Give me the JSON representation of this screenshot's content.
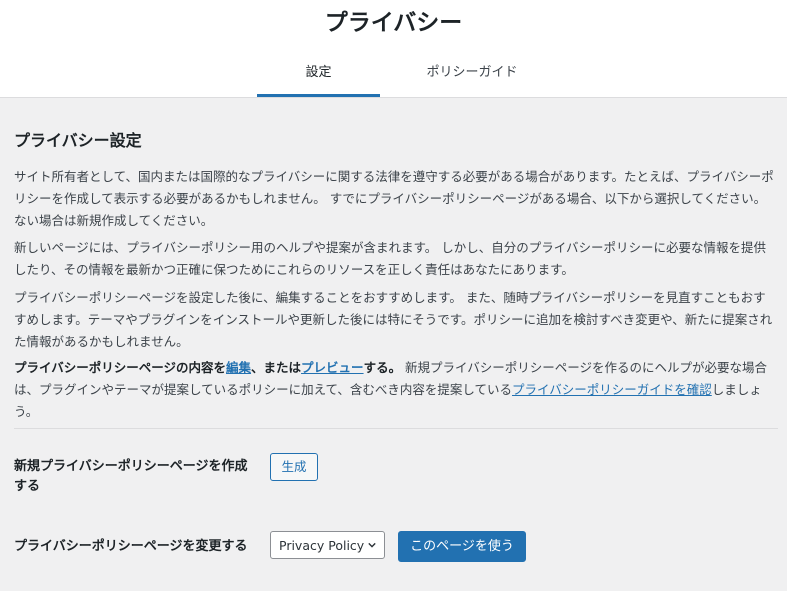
{
  "header": {
    "title": "プライバシー",
    "tabs": [
      {
        "label": "設定",
        "active": true
      },
      {
        "label": "ポリシーガイド",
        "active": false
      }
    ]
  },
  "section": {
    "title": "プライバシー設定",
    "p1": "サイト所有者として、国内または国際的なプライバシーに関する法律を遵守する必要がある場合があります。たとえば、プライバシーポリシーを作成して表示する必要があるかもしれません。 すでにプライバシーポリシーページがある場合、以下から選択してください。ない場合は新規作成してください。",
    "p2": "新しいページには、プライバシーポリシー用のヘルプや提案が含まれます。 しかし、自分のプライバシーポリシーに必要な情報を提供したり、その情報を最新かつ正確に保つためにこれらのリソースを正しく責任はあなたにあります。",
    "p3": "プライバシーポリシーページを設定した後に、編集することをおすすめします。 また、随時プライバシーポリシーを見直すこともおすすめします。テーマやプラグインをインストールや更新した後には特にそうです。ポリシーに追加を検討すべき変更や、新たに提案された情報があるかもしれません。",
    "p4": {
      "strong_prefix": "プライバシーポリシーページの内容を",
      "edit_link": "編集",
      "strong_mid": "、または",
      "preview_link": "プレビュー",
      "strong_suffix": "する。",
      "text_a": " 新規プライバシーポリシーページを作るのにヘルプが必要な場合は、プラグインやテーマが提案しているポリシーに加えて、含むべき内容を提案している",
      "guide_link": "プライバシーポリシーガイドを確認",
      "text_b": "しましょう。"
    }
  },
  "create_row": {
    "label": "新規プライバシーポリシーページを作成する",
    "button": "生成"
  },
  "change_row": {
    "label": "プライバシーポリシーページを変更する",
    "select_value": "Privacy Policy",
    "button": "このページを使う"
  },
  "colors": {
    "accent": "#2271b1",
    "background": "#f0f0f1",
    "header_background": "#ffffff"
  },
  "icons": {
    "select_arrow": "chevron-down-icon"
  }
}
